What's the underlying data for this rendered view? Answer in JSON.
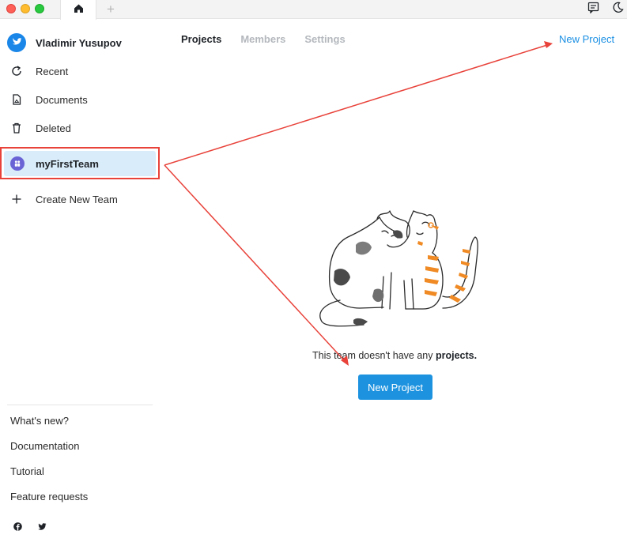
{
  "titlebar": {
    "tabs": [
      {
        "icon": "home-icon",
        "active": true
      }
    ],
    "add_tab_label": "+",
    "right_icons": [
      "feedback-icon",
      "dark-mode-moon-icon"
    ]
  },
  "sidebar": {
    "user_name": "Vladimir Yusupov",
    "avatar_icon": "bird-logo-icon",
    "items": [
      {
        "label": "Recent",
        "icon": "refresh-icon"
      },
      {
        "label": "Documents",
        "icon": "document-icon"
      },
      {
        "label": "Deleted",
        "icon": "trash-icon"
      }
    ],
    "team": {
      "label": "myFirstTeam",
      "icon": "team-icon",
      "selected": true
    },
    "create_team_label": "Create New Team",
    "bottom_links": [
      "What's new?",
      "Documentation",
      "Tutorial",
      "Feature requests"
    ],
    "social_icons": [
      "facebook-icon",
      "twitter-icon"
    ]
  },
  "main": {
    "tabs": [
      {
        "label": "Projects",
        "active": true
      },
      {
        "label": "Members",
        "active": false
      },
      {
        "label": "Settings",
        "active": false
      }
    ],
    "top_new_project_label": "New Project",
    "empty_message_prefix": "This team doesn't have any",
    "empty_message_bold": "projects.",
    "new_project_button_label": "New Project"
  },
  "colors": {
    "accent": "#1d93e0",
    "annotation": "#e8423a",
    "selected_bg": "#d9ecf9",
    "team_icon": "#6a63d6"
  }
}
